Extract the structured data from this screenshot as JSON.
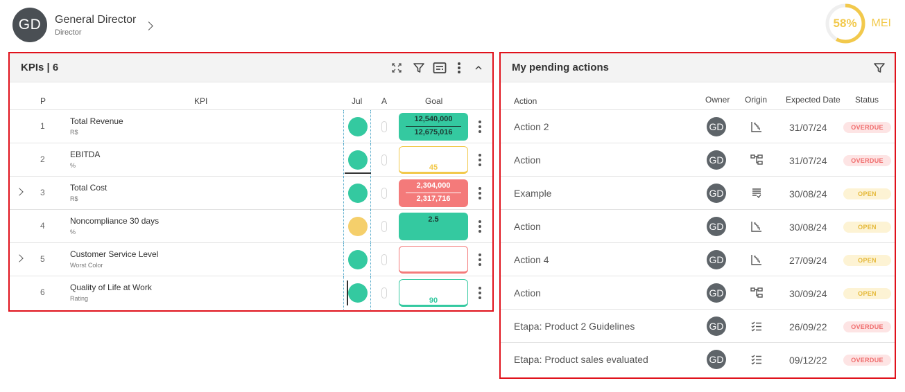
{
  "user": {
    "initials": "GD",
    "name": "General Director",
    "role": "Director"
  },
  "mei": {
    "value": "58%",
    "label": "MEI",
    "percent": 58,
    "color": "#f2c94c"
  },
  "kpi_panel": {
    "title": "KPIs | 6",
    "columns": {
      "p": "P",
      "kpi": "KPI",
      "month": "Jul",
      "a": "A",
      "goal": "Goal"
    },
    "rows": [
      {
        "expandable": false,
        "p": "1",
        "name": "Total Revenue",
        "unit": "R$",
        "status_color": "green",
        "mark": "",
        "goal_style": "green-fill",
        "goal_top": "12,540,000",
        "goal_bottom": "12,675,016"
      },
      {
        "expandable": false,
        "p": "2",
        "name": "EBITDA",
        "unit": "%",
        "status_color": "green",
        "mark": "underline",
        "goal_style": "yellow-out",
        "goal_single": "45"
      },
      {
        "expandable": true,
        "p": "3",
        "name": "Total Cost",
        "unit": "R$",
        "status_color": "green",
        "mark": "",
        "goal_style": "red-fill",
        "goal_top": "2,304,000",
        "goal_bottom": "2,317,716"
      },
      {
        "expandable": false,
        "p": "4",
        "name": "Noncompliance 30 days",
        "unit": "%",
        "status_color": "yellow",
        "mark": "",
        "goal_style": "green-fill",
        "goal_single_top": "2.5"
      },
      {
        "expandable": true,
        "p": "5",
        "name": "Customer Service Level",
        "unit": "Worst Color",
        "status_color": "green",
        "mark": "",
        "goal_style": "red-out"
      },
      {
        "expandable": false,
        "p": "6",
        "name": "Quality of Life at Work",
        "unit": "Rating",
        "status_color": "green",
        "mark": "leftbar",
        "goal_style": "green-out",
        "goal_single": "90"
      }
    ]
  },
  "actions_panel": {
    "title": "My pending actions",
    "columns": {
      "action": "Action",
      "owner": "Owner",
      "origin": "Origin",
      "date": "Expected Date",
      "status": "Status"
    },
    "rows": [
      {
        "name": "Action 2",
        "owner": "GD",
        "origin_icon": "chart-icon",
        "date": "31/07/24",
        "status": "OVERDUE",
        "status_type": "overdue"
      },
      {
        "name": "Action",
        "owner": "GD",
        "origin_icon": "hierarchy-icon",
        "date": "31/07/24",
        "status": "OVERDUE",
        "status_type": "overdue"
      },
      {
        "name": "Example",
        "owner": "GD",
        "origin_icon": "document-check-icon",
        "date": "30/08/24",
        "status": "OPEN",
        "status_type": "open"
      },
      {
        "name": "Action",
        "owner": "GD",
        "origin_icon": "chart-icon",
        "date": "30/08/24",
        "status": "OPEN",
        "status_type": "open"
      },
      {
        "name": "Action 4",
        "owner": "GD",
        "origin_icon": "chart-icon",
        "date": "27/09/24",
        "status": "OPEN",
        "status_type": "open"
      },
      {
        "name": "Action",
        "owner": "GD",
        "origin_icon": "hierarchy-icon",
        "date": "30/09/24",
        "status": "OPEN",
        "status_type": "open"
      },
      {
        "name": "Etapa: Product 2 Guidelines",
        "owner": "GD",
        "origin_icon": "checklist-icon",
        "date": "26/09/22",
        "status": "OVERDUE",
        "status_type": "overdue"
      },
      {
        "name": "Etapa: Product sales evaluated",
        "owner": "GD",
        "origin_icon": "checklist-icon",
        "date": "09/12/22",
        "status": "OVERDUE",
        "status_type": "overdue"
      }
    ]
  }
}
